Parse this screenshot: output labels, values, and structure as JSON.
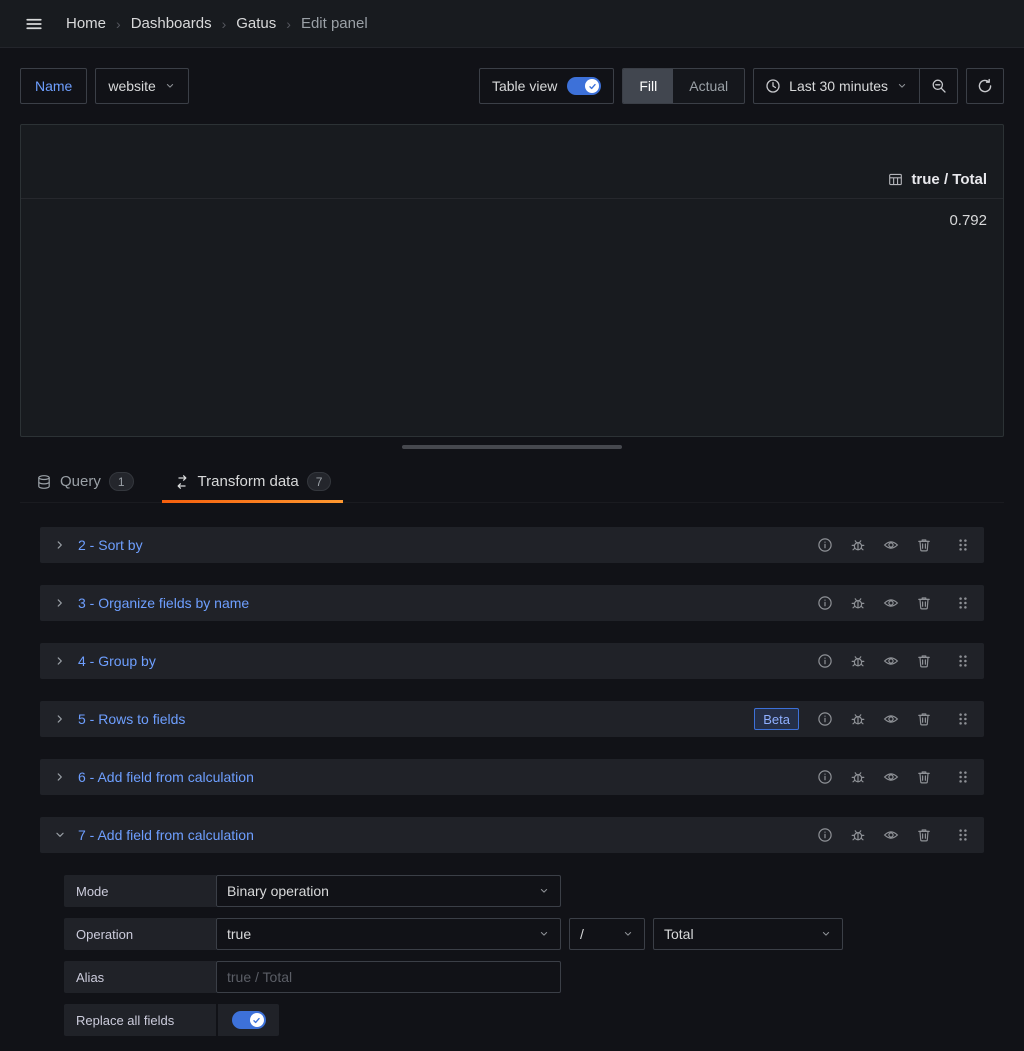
{
  "colors": {
    "accent_orange": "#ff780a",
    "link_blue": "#6e9fff",
    "toggle_blue": "#3d71d9"
  },
  "breadcrumb": {
    "separator": "›",
    "items": [
      "Home",
      "Dashboards",
      "Gatus",
      "Edit panel"
    ]
  },
  "toolbar": {
    "name_label": "Name",
    "panel_name": "website",
    "table_view_label": "Table view",
    "fill_label": "Fill",
    "actual_label": "Actual",
    "time_range": "Last 30 minutes"
  },
  "panel": {
    "column_header": "true / Total",
    "value": "0.792"
  },
  "tabs": {
    "query": {
      "label": "Query",
      "count": "1"
    },
    "transform": {
      "label": "Transform data",
      "count": "7"
    }
  },
  "transformations": [
    {
      "title": "2 - Sort by"
    },
    {
      "title": "3 - Organize fields by name"
    },
    {
      "title": "4 - Group by"
    },
    {
      "title": "5 - Rows to fields",
      "badge": "Beta"
    },
    {
      "title": "6 - Add field from calculation"
    },
    {
      "title": "7 - Add field from calculation"
    }
  ],
  "form": {
    "mode_label": "Mode",
    "mode_value": "Binary operation",
    "operation_label": "Operation",
    "left_value": "true",
    "operator_value": "/",
    "right_value": "Total",
    "alias_label": "Alias",
    "alias_placeholder": "true / Total",
    "replace_label": "Replace all fields"
  },
  "icons": {
    "menu-icon": "hamburger ☰",
    "clock-icon": "clock",
    "zoom-out-icon": "magnifier-minus",
    "refresh-icon": "circular-arrow",
    "table-icon": "grid",
    "database-icon": "db-cylinder",
    "transform-icon": "process-arrows",
    "info-icon": "circle-i",
    "debug-icon": "bug",
    "eye-icon": "eye",
    "trash-icon": "trash-can",
    "drag-icon": "six-dots",
    "chevron-right-icon": "›",
    "chevron-down-icon": "⌄",
    "check-icon": "✓"
  }
}
